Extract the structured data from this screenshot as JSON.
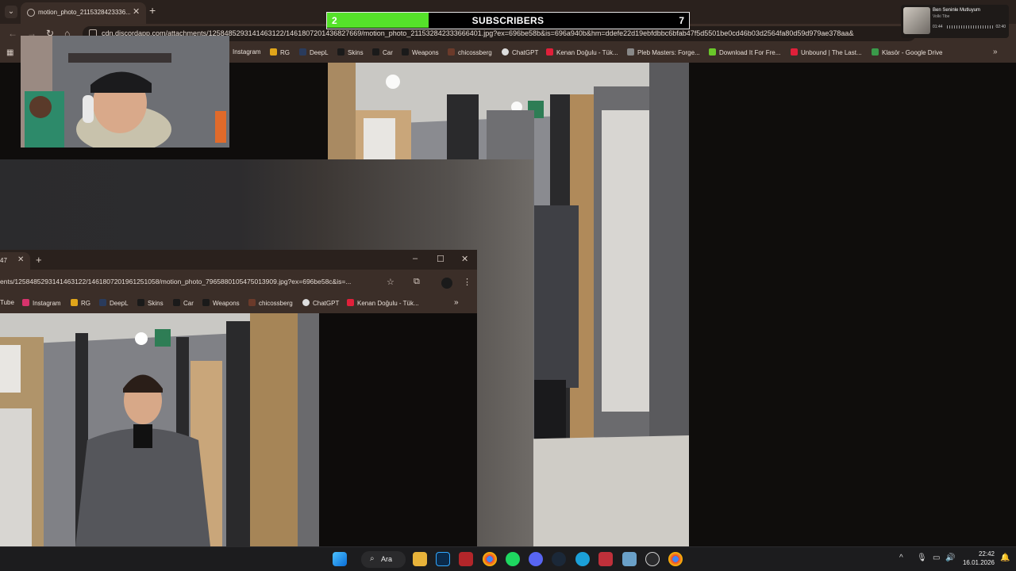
{
  "main_browser": {
    "tab_title": "motion_photo_2115328423336...",
    "url": "cdn.discordapp.com/attachments/1258485293141463122/1461807201436827669/motion_photo_211532842333666401.jpg?ex=696be58b&is=696a940b&hm=ddefe22d19ebfdbbc6bfab47f5d5501be0cd46b03d2564fa80d59d979ae378aa&",
    "bookmarks": [
      "Instagram",
      "RG",
      "DeepL",
      "Skins",
      "Car",
      "Weapons",
      "chicossberg",
      "ChatGPT",
      "Kenan Doğulu - Tük...",
      "Pleb Masters: Forge...",
      "Download It For Fre...",
      "Unbound | The Last...",
      "Klasör - Google Drive"
    ]
  },
  "sub_counter": {
    "low": "2",
    "label": "SUBSCRIBERS",
    "high": "7",
    "progress_fraction": 0.28
  },
  "music_widget": {
    "song": "Ben Seninle Mutluyum",
    "artist": "Volki Tibe",
    "elapsed": "01:44",
    "duration": "02:40"
  },
  "second_browser": {
    "tab_title": "47",
    "url": "ents/1258485293141463122/1461807201961251058/motion_photo_7965880105475013909.jpg?ex=696be58c&is=...",
    "bookmarks": [
      "Tube",
      "Instagram",
      "RG",
      "DeepL",
      "Skins",
      "Car",
      "Weapons",
      "chicossberg",
      "ChatGPT",
      "Kenan Doğulu - Tük..."
    ]
  },
  "taskbar": {
    "search_label": "Ara",
    "time": "22:42",
    "date": "16.01.2026"
  },
  "colors": {
    "chrome_bg": "#3b2e28",
    "tabstrip_bg": "#2a211d",
    "counter_fill": "#55e22a"
  }
}
